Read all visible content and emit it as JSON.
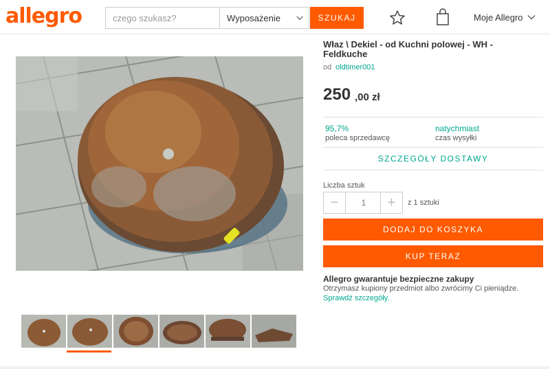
{
  "header": {
    "logo": "allegro",
    "search_placeholder": "czego szukasz?",
    "category": "Wyposażenie",
    "search_button": "SZUKAJ",
    "account_label": "Moje Allegro",
    "icons": [
      "star-icon",
      "shopping-bag-icon",
      "chevron-down-icon"
    ]
  },
  "product": {
    "title": "Właz \\ Dekiel - od Kuchni polowej - WH - Feldkuche",
    "seller_prefix": "od",
    "seller_name": "oldtimer001",
    "price_int": "250",
    "price_dec": ",00 zł",
    "stats": {
      "recommend_value": "95,7%",
      "recommend_label": "poleca sprzedawcę",
      "shipping_value": "natychmiast",
      "shipping_label": "czas wysyłki"
    },
    "delivery_link": "SZCZEGÓŁY DOSTAWY",
    "quantity": {
      "label": "Liczba sztuk",
      "value": "1",
      "minus": "−",
      "plus": "+",
      "available": "z 1 sztuki"
    },
    "add_to_cart": "DODAJ DO KOSZYKA",
    "buy_now": "KUP TERAZ",
    "guarantee": {
      "title": "Allegro gwarantuje bezpieczne zakupy",
      "text": "Otrzymasz kupiony przedmiot albo zwrócimy Ci pieniądze.",
      "link": "Sprawdź szczegóły."
    }
  },
  "gallery": {
    "thumbnail_count": 6,
    "active_index": 1
  },
  "colors": {
    "brand_orange": "#ff5a00",
    "link_teal": "#00a790"
  }
}
